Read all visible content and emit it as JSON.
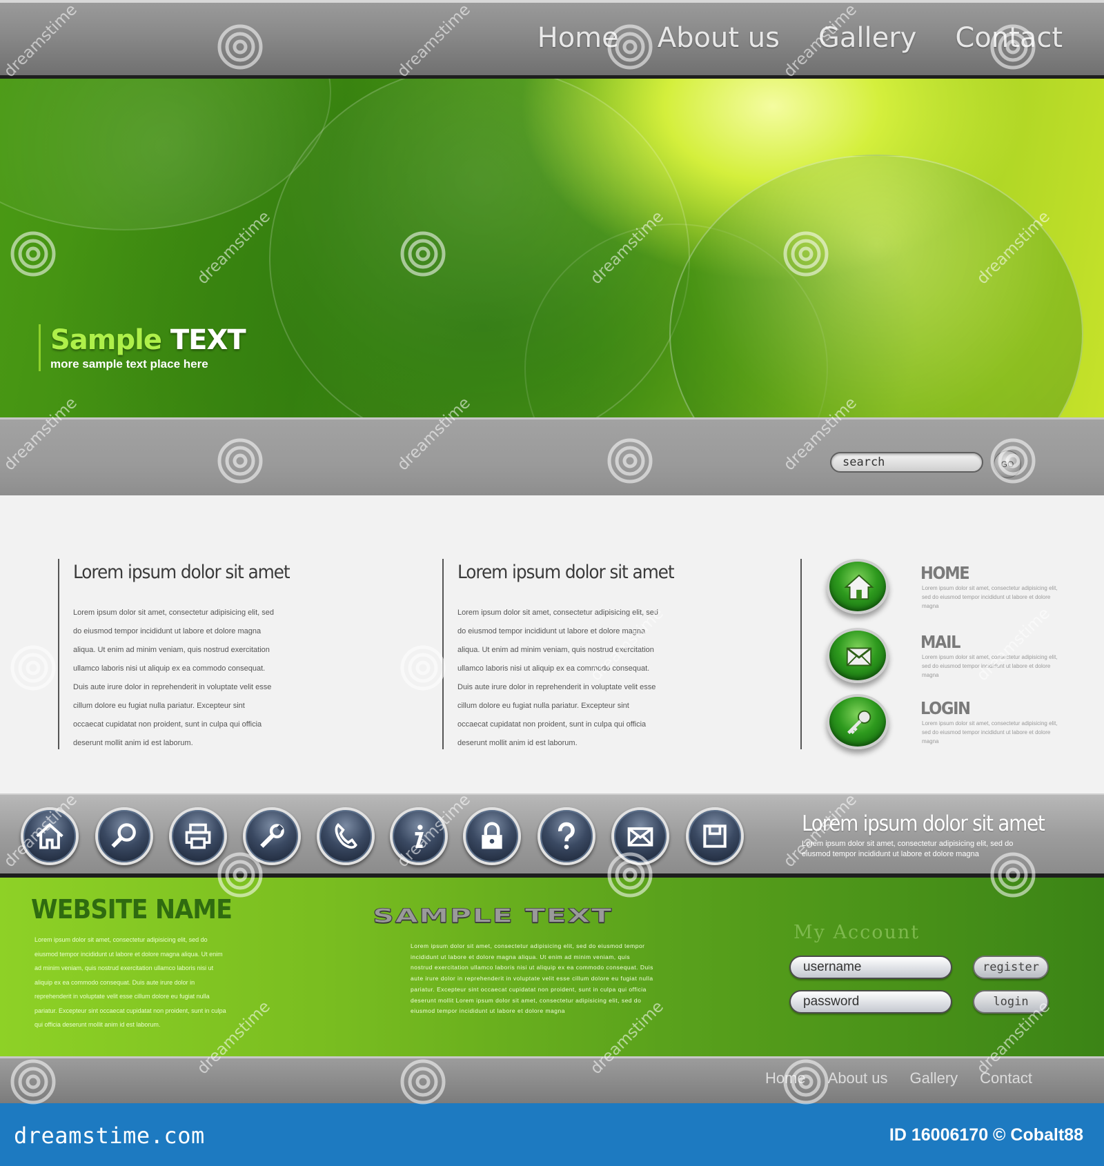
{
  "top_nav": {
    "items": [
      "Home",
      "About us",
      "Gallery",
      "Contact"
    ]
  },
  "hero": {
    "title_main": "Sample ",
    "title_accent": "TEXT",
    "subtitle": "more sample text place here"
  },
  "search": {
    "placeholder": "search",
    "go_label": "GO"
  },
  "columns": [
    {
      "title": "Lorem ipsum dolor sit amet",
      "body": "Lorem ipsum dolor sit amet, consectetur adipisicing elit, sed do eiusmod tempor incididunt ut labore et dolore magna aliqua. Ut enim ad minim veniam, quis nostrud exercitation ullamco laboris nisi ut aliquip ex ea commodo consequat. Duis aute irure dolor in reprehenderit in voluptate velit esse cillum dolore eu fugiat nulla pariatur. Excepteur sint occaecat cupidatat non proident, sunt in culpa qui officia deserunt mollit anim id est laborum."
    },
    {
      "title": "Lorem ipsum dolor sit amet",
      "body": "Lorem ipsum dolor sit amet, consectetur adipisicing elit, sed do eiusmod tempor incididunt ut labore et dolore magna aliqua. Ut enim ad minim veniam, quis nostrud exercitation ullamco laboris nisi ut aliquip ex ea commodo consequat. Duis aute irure dolor in reprehenderit in voluptate velit esse cillum dolore eu fugiat nulla pariatur. Excepteur sint occaecat cupidatat non proident, sunt in culpa qui officia deserunt mollit anim id est laborum."
    }
  ],
  "features": [
    {
      "title": "HOME",
      "icon": "home-icon",
      "text": "Lorem ipsum dolor sit amet, consectetur adipisicing elit, sed do eiusmod tempor incididunt ut labore et dolore magna"
    },
    {
      "title": "MAIL",
      "icon": "mail-icon",
      "text": "Lorem ipsum dolor sit amet, consectetur adipisicing elit, sed do eiusmod tempor incididunt ut labore et dolore magna"
    },
    {
      "title": "LOGIN",
      "icon": "key-icon",
      "text": "Lorem ipsum dolor sit amet, consectetur adipisicing elit, sed do eiusmod tempor incididunt ut labore et dolore magna"
    }
  ],
  "icon_bar": {
    "icons": [
      "home-icon",
      "search-icon",
      "printer-icon",
      "wrench-icon",
      "phone-icon",
      "info-icon",
      "lock-icon",
      "help-icon",
      "mail-icon",
      "save-icon"
    ],
    "title": "Lorem ipsum dolor sit amet",
    "text": "Lorem ipsum dolor sit amet, consectetur adipisicing elit, sed do eiusmod tempor incididunt ut labore et dolore magna"
  },
  "footer_green": {
    "site_name": "WEBSITE NAME",
    "site_text": "Lorem ipsum dolor sit amet, consectetur adipisicing elit, sed do eiusmod tempor incididunt ut labore et dolore magna aliqua. Ut enim ad minim veniam, quis nostrud exercitation ullamco laboris nisi ut aliquip ex ea commodo consequat. Duis aute irure dolor in reprehenderit in voluptate velit esse cillum dolore eu fugiat nulla pariatur. Excepteur sint occaecat cupidatat non proident, sunt in culpa qui officia deserunt mollit anim id est laborum.",
    "sample_logo": "SAMPLE TEXT",
    "mid_text": "Lorem ipsum dolor sit amet, consectetur adipisicing elit, sed do eiusmod tempor incididunt ut labore et dolore magna aliqua. Ut enim ad minim veniam, quis nostrud exercitation ullamco laboris nisi ut aliquip ex ea commodo consequat. Duis aute irure dolor in reprehenderit in voluptate velit esse cillum dolore eu fugiat nulla pariatur. Excepteur sint occaecat cupidatat non proident, sunt in culpa qui officia deserunt mollit Lorem ipsum dolor sit amet, consectetur adipisicing elit, sed do eiusmod tempor incididunt ut labore et dolore magna",
    "account_title": "My Account",
    "username_placeholder": "username",
    "password_placeholder": "password",
    "register_label": "register",
    "login_label": "login"
  },
  "bottom_nav": {
    "items": [
      "Home",
      "About us",
      "Gallery",
      "Contact"
    ]
  },
  "stock": {
    "logo": "dreamstime.com",
    "id_text": "ID 16006170 © Cobalt88",
    "watermark": "dreamstime"
  },
  "colors": {
    "hero_green": "#3a8410",
    "accent_lime": "#aef04a",
    "footer_green": "#79bd20",
    "stock_blue": "#1d7ac1",
    "icon_navy": "#3b4a63"
  }
}
